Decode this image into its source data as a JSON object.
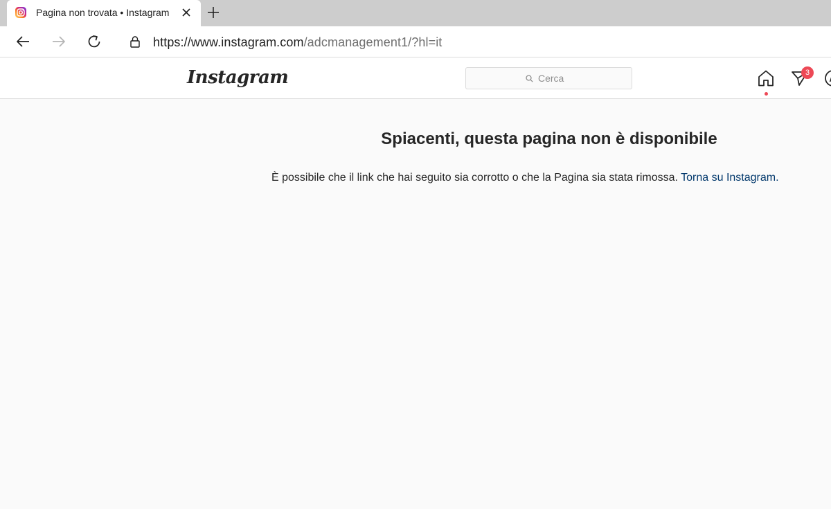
{
  "browser": {
    "tab": {
      "title": "Pagina non trovata • Instagram",
      "favicon": "instagram-favicon"
    },
    "address": {
      "url_host": "https://www.instagram.com",
      "url_path": "/adcmanagement1/?hl=it"
    },
    "icons": {
      "back": "back-arrow-icon",
      "forward": "forward-arrow-icon",
      "refresh": "refresh-icon",
      "lock": "lock-icon",
      "close": "close-icon",
      "new_tab": "plus-icon"
    }
  },
  "header": {
    "logo": "Instagram",
    "search_placeholder": "Cerca",
    "direct_badge": "3",
    "notification_color": "#ed4956"
  },
  "content": {
    "title": "Spiacenti, questa pagina non è disponibile",
    "message": "È possibile che il link che hai seguito sia corrotto o che la Pagina sia stata rimossa.",
    "link_text": "Torna su Instagram.",
    "link_color": "#00376b"
  }
}
